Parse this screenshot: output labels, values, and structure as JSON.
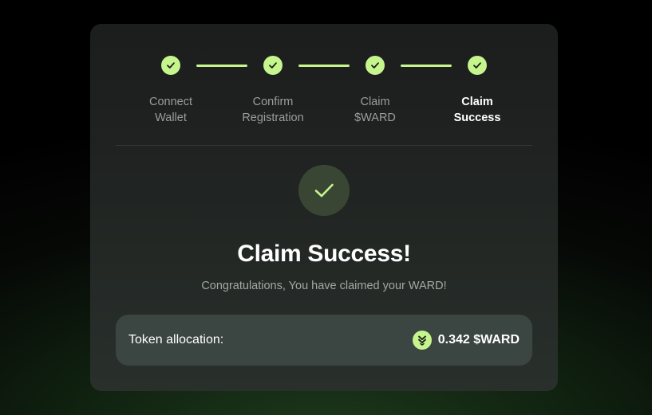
{
  "steps": [
    {
      "line1": "Connect",
      "line2": "Wallet",
      "status": "complete"
    },
    {
      "line1": "Confirm",
      "line2": "Registration",
      "status": "complete"
    },
    {
      "line1": "Claim",
      "line2": "$WARD",
      "status": "complete"
    },
    {
      "line1": "Claim",
      "line2": "Success",
      "status": "active"
    }
  ],
  "result": {
    "title": "Claim Success!",
    "subtitle": "Congratulations, You have claimed your WARD!"
  },
  "allocation": {
    "label": "Token allocation:",
    "value": "0.342 $WARD",
    "icon": "ward-token-icon"
  },
  "colors": {
    "accent": "#c6f58e",
    "card_background": "#202422",
    "allocation_background": "#3b4541",
    "success_circle": "#3a4634"
  }
}
